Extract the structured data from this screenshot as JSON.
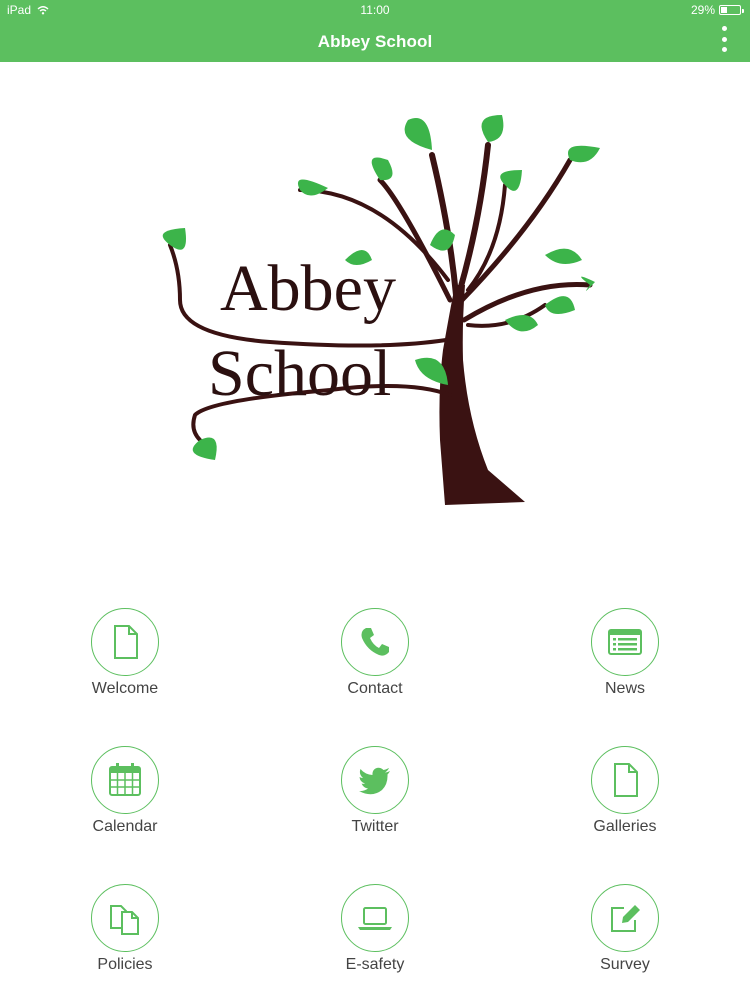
{
  "status_bar": {
    "device": "iPad",
    "time": "11:00",
    "battery": "29%",
    "battery_level": 0.29
  },
  "header": {
    "title": "Abbey School",
    "menu_icon": "vertical-dots-icon"
  },
  "logo": {
    "line1": "Abbey",
    "line2": "School",
    "icon": "tree-logo"
  },
  "colors": {
    "accent": "#5cbf5f",
    "trunk": "#3a1212",
    "leaf": "#3cb44a",
    "label": "#444444"
  },
  "menu": [
    {
      "label": "Welcome",
      "icon": "document-icon"
    },
    {
      "label": "Contact",
      "icon": "phone-icon"
    },
    {
      "label": "News",
      "icon": "news-icon"
    },
    {
      "label": "Calendar",
      "icon": "calendar-icon"
    },
    {
      "label": "Twitter",
      "icon": "twitter-bird-icon"
    },
    {
      "label": "Galleries",
      "icon": "document-icon"
    },
    {
      "label": "Policies",
      "icon": "copy-documents-icon"
    },
    {
      "label": "E-safety",
      "icon": "laptop-icon"
    },
    {
      "label": "Survey",
      "icon": "edit-pencil-icon"
    }
  ]
}
